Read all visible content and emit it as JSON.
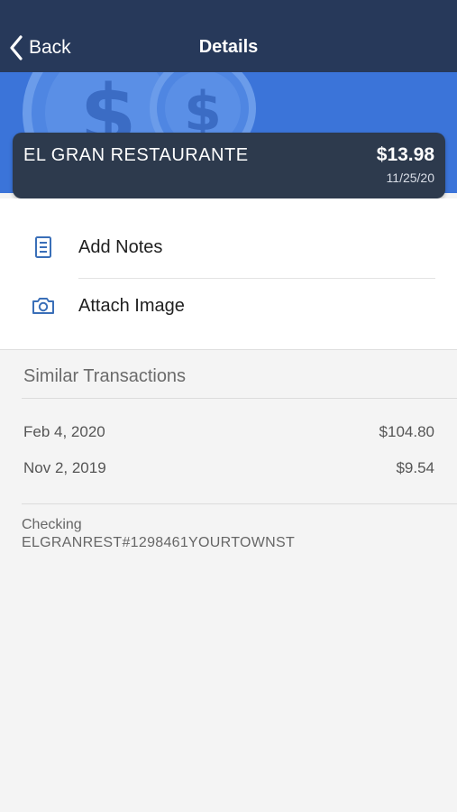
{
  "navbar": {
    "back_label": "Back",
    "title": "Details"
  },
  "transaction": {
    "merchant": "EL GRAN RESTAURANTE",
    "amount": "$13.98",
    "date": "11/25/20"
  },
  "actions": [
    {
      "label": "Add Notes",
      "icon": "notes-icon"
    },
    {
      "label": "Attach Image",
      "icon": "camera-icon"
    }
  ],
  "similar": {
    "header": "Similar Transactions",
    "items": [
      {
        "date": "Feb 4, 2020",
        "amount": "$104.80"
      },
      {
        "date": "Nov 2, 2019",
        "amount": "$9.54"
      }
    ]
  },
  "account": {
    "type": "Checking",
    "description": "ELGRANREST#1298461YOURTOWNST"
  },
  "colors": {
    "navbar": "#27395a",
    "banner": "#3b74d9",
    "card": "#2d3a4d",
    "icon_accent": "#3a6fb8"
  }
}
